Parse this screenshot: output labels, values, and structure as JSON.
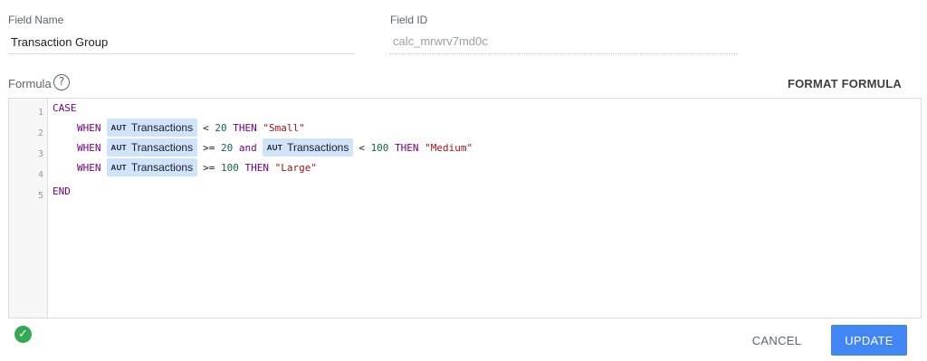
{
  "field_name": {
    "label": "Field Name",
    "value": "Transaction Group"
  },
  "field_id": {
    "label": "Field ID",
    "value": "calc_mrwrv7md0c"
  },
  "formula": {
    "label": "Formula",
    "help_glyph": "?",
    "format_button": "FORMAT FORMULA",
    "line_numbers": [
      "1",
      "2",
      "3",
      "4",
      "5"
    ],
    "chip_type": "AUT",
    "chip_field": "Transactions",
    "lines": {
      "l1": {
        "case": "CASE"
      },
      "l2": {
        "when": "WHEN",
        "op": "<",
        "num": "20",
        "then": "THEN",
        "str": "\"Small\""
      },
      "l3": {
        "when": "WHEN",
        "op1": ">=",
        "num1": "20",
        "and": "and",
        "op2": "<",
        "num2": "100",
        "then": "THEN",
        "str": "\"Medium\""
      },
      "l4": {
        "when": "WHEN",
        "op": ">=",
        "num": "100",
        "then": "THEN",
        "str": "\"Large\""
      },
      "l5": {
        "end": "END"
      }
    },
    "status": "valid",
    "status_glyph": "✓"
  },
  "actions": {
    "cancel": "CANCEL",
    "update": "UPDATE"
  },
  "colors": {
    "accent": "#4285f4",
    "valid": "#34a853",
    "keyword": "#770088",
    "number": "#116644",
    "string": "#aa1111",
    "chip": "#cfe3fa"
  }
}
